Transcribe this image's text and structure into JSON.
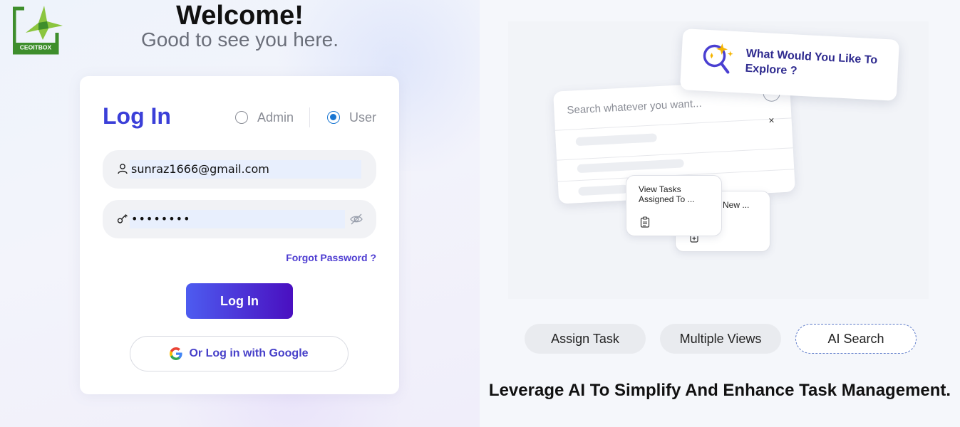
{
  "brand": {
    "logo_text": "CEOITBOX"
  },
  "welcome": {
    "title": "Welcome!",
    "subtitle": "Good to see you here."
  },
  "login": {
    "title": "Log In",
    "roles": [
      {
        "label": "Admin",
        "checked": false
      },
      {
        "label": "User",
        "checked": true
      }
    ],
    "email_value": "sunraz1666@gmail.com",
    "password_mask": "••••••••",
    "forgot_label": "Forgot Password ?",
    "submit_label": "Log In",
    "google_label": "Or Log in with Google"
  },
  "illustration": {
    "explore_text": "What Would You Like To Explore ?",
    "search_placeholder": "Search whatever you want...",
    "close_glyph": "×",
    "card_front": "View Tasks Assigned To ...",
    "card_back": "New ..."
  },
  "feature_tabs": [
    {
      "label": "Assign Task",
      "active": false
    },
    {
      "label": "Multiple Views",
      "active": false
    },
    {
      "label": "AI Search",
      "active": true
    }
  ],
  "tagline": "Leverage AI To Simplify And Enhance Task Management.",
  "colors": {
    "primary": "#3b3fd8",
    "button_gradient_start": "#4d5cf0",
    "button_gradient_end": "#4a0fc0",
    "radio_checked": "#1976d2",
    "logo_green": "#3e8e2c"
  },
  "icons": [
    "user-icon",
    "key-icon",
    "eye-off-icon",
    "google-icon",
    "ai-search-icon",
    "clipboard-icon",
    "plus-square-icon",
    "arrow-icon"
  ]
}
